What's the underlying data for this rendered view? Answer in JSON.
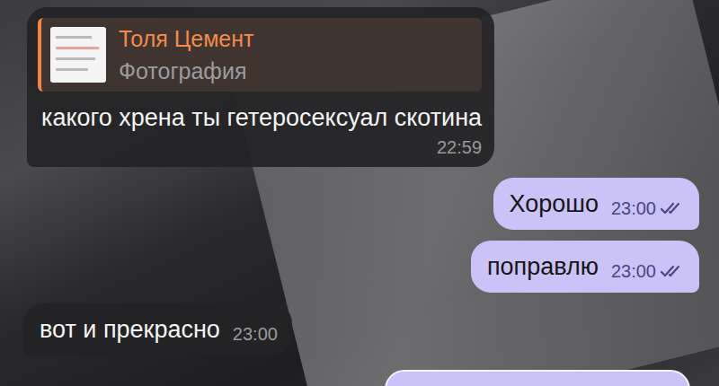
{
  "chat": {
    "messages": [
      {
        "direction": "incoming",
        "reply": {
          "author": "Толя Цемент",
          "label": "Фотография"
        },
        "text": "какого хрена ты гетеросексуал скотина",
        "time": "22:59",
        "read": false
      },
      {
        "direction": "outgoing",
        "text": "Хорошо",
        "time": "23:00",
        "read": true
      },
      {
        "direction": "outgoing",
        "text": "поправлю",
        "time": "23:00",
        "read": true
      },
      {
        "direction": "incoming",
        "text": "вот и прекрасно",
        "time": "23:00",
        "read": false
      }
    ]
  }
}
